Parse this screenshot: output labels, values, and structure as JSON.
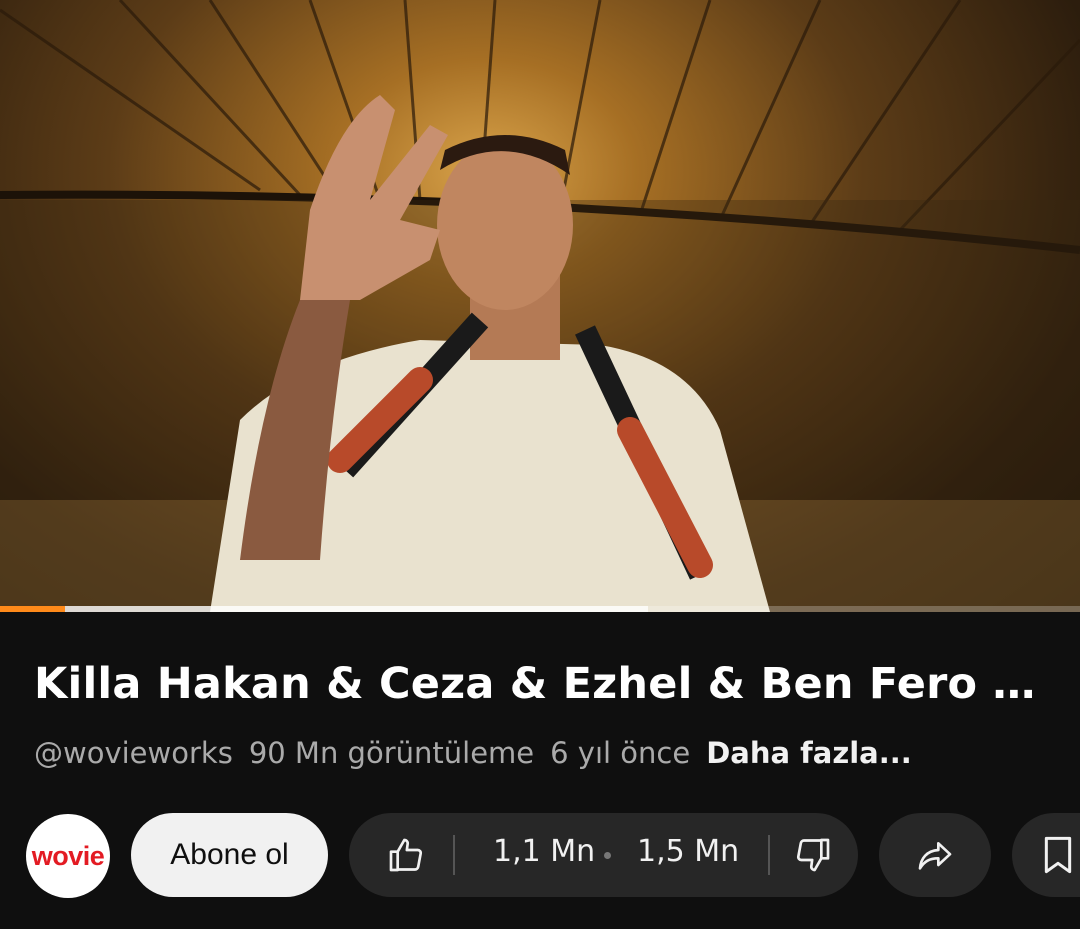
{
  "video": {
    "title": "Killa Hakan & Ceza & Ezhel & Ben Fero - Fig...",
    "progress_played": 0.06,
    "progress_buffered": 0.6
  },
  "meta": {
    "channel_handle": "@wovieworks",
    "views": "90 Mn görüntüleme",
    "age": "6 yıl önce",
    "more_label": "Daha fazla..."
  },
  "channel": {
    "avatar_text": "wovie",
    "avatar_color": "#e31b23"
  },
  "actions": {
    "subscribe_label": "Abone ol",
    "like_count": "1,1 Mn",
    "comment_count": "1,5 Mn",
    "like_icon": "thumbs-up-icon",
    "dislike_icon": "thumbs-down-icon",
    "share_icon": "share-icon",
    "save_icon": "bookmark-icon"
  },
  "colors": {
    "background": "#0f0f0f",
    "chip": "#272727",
    "progress": "#ff8a1a"
  }
}
